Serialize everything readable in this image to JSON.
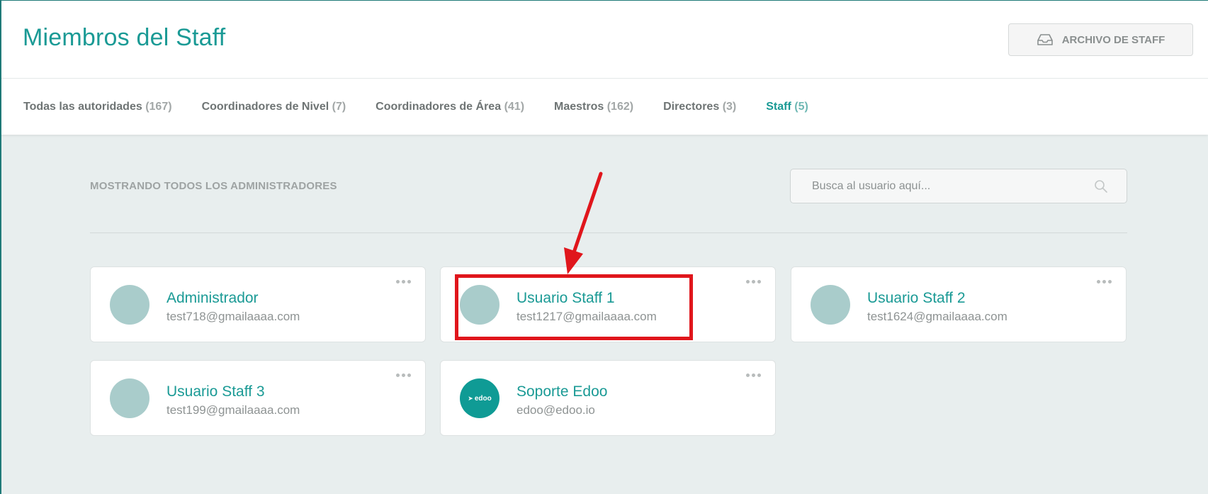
{
  "header": {
    "title": "Miembros del Staff",
    "archive_button": "ARCHIVO DE STAFF"
  },
  "tabs": [
    {
      "label": "Todas las autoridades",
      "count": "(167)",
      "active": false
    },
    {
      "label": "Coordinadores de Nivel",
      "count": "(7)",
      "active": false
    },
    {
      "label": "Coordinadores de Área",
      "count": "(41)",
      "active": false
    },
    {
      "label": "Maestros",
      "count": "(162)",
      "active": false
    },
    {
      "label": "Directores",
      "count": "(3)",
      "active": false
    },
    {
      "label": "Staff",
      "count": "(5)",
      "active": true
    }
  ],
  "main": {
    "section_label": "MOSTRANDO TODOS LOS ADMINISTRADORES",
    "search": {
      "placeholder": "Busca al usuario aquí...",
      "value": ""
    }
  },
  "users": [
    {
      "name": "Administrador",
      "email": "test718@gmailaaaa.com"
    },
    {
      "name": "Usuario Staff 1",
      "email": "test1217@gmailaaaa.com"
    },
    {
      "name": "Usuario Staff 2",
      "email": "test1624@gmailaaaa.com"
    },
    {
      "name": "Usuario Staff 3",
      "email": "test199@gmailaaaa.com"
    },
    {
      "name": "Soporte Edoo",
      "email": "edoo@edoo.io",
      "avatar_text": "edoo"
    }
  ],
  "colors": {
    "accent": "#1a9a95",
    "background": "#e8eeee",
    "annotation": "#e0161c"
  }
}
